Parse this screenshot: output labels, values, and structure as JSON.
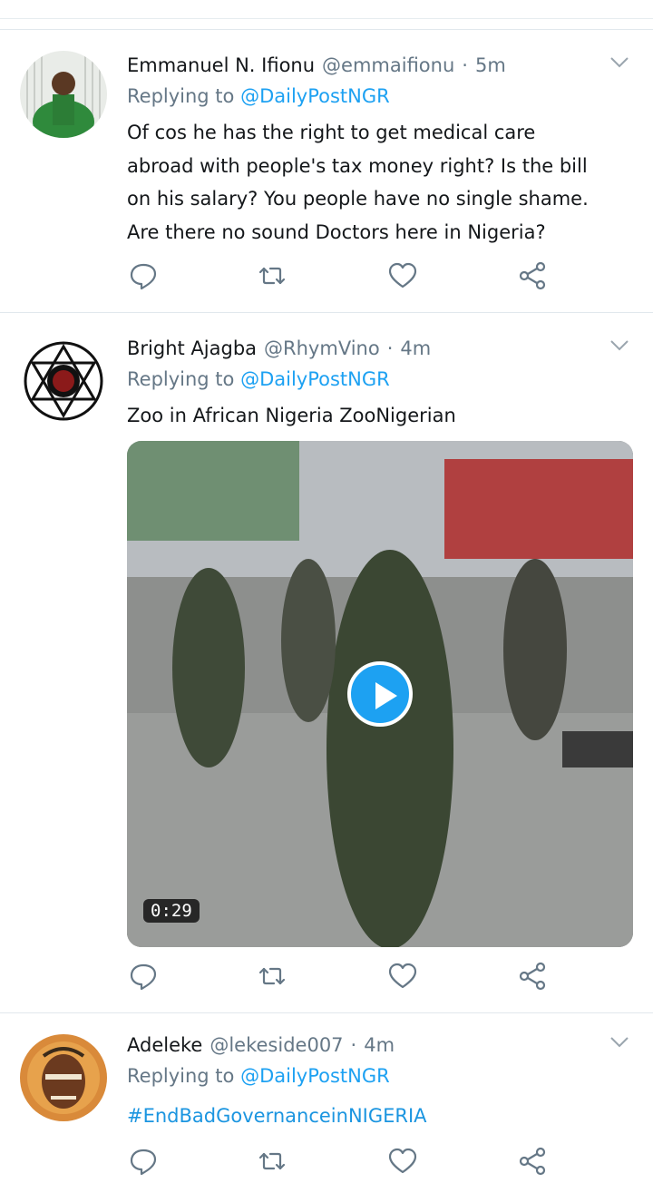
{
  "tweets": [
    {
      "name": "Emmanuel N. Ifionu",
      "handle": "@emmaifionu",
      "dot": "·",
      "time": "5m",
      "replying_prefix": "Replying to",
      "replying_to": "@DailyPostNGR",
      "lines": [
        "Of cos he has the right to get medical care",
        "abroad with people's tax money right? Is the bill",
        "on his salary? You people have no single shame.",
        "Are there no sound Doctors here in Nigeria?"
      ]
    },
    {
      "name": "Bright Ajagba",
      "handle": "@RhymVino",
      "dot": "·",
      "time": "4m",
      "replying_prefix": "Replying to",
      "replying_to": "@DailyPostNGR",
      "lines": [
        "Zoo in African Nigeria ZooNigerian"
      ],
      "video": {
        "duration": "0:29"
      }
    },
    {
      "name": "Adeleke",
      "handle": "@lekeside007",
      "dot": "·",
      "time": "4m",
      "replying_prefix": "Replying to",
      "replying_to": "@DailyPostNGR",
      "hashtag": "#EndBadGovernanceinNIGERIA"
    }
  ],
  "icons": {
    "reply": "reply-icon",
    "retweet": "retweet-icon",
    "like": "like-icon",
    "share": "share-icon",
    "more": "chevron-down-icon",
    "play": "play-icon"
  },
  "colors": {
    "link": "#1da1f2",
    "secondary_text": "#657786",
    "icon": "#657786",
    "separator": "#e1e8ed"
  }
}
